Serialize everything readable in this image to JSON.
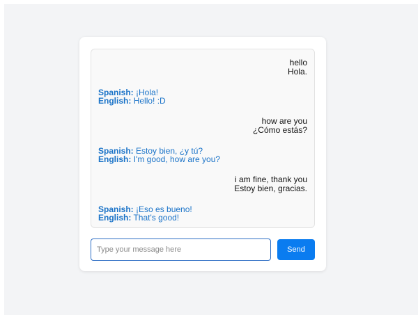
{
  "chat": {
    "messages": [
      {
        "role": "user",
        "text": "hello",
        "translation": "Hola."
      },
      {
        "role": "bot",
        "spanish_label": "Spanish:",
        "spanish": "¡Hola!",
        "english_label": "English:",
        "english": "Hello! :D"
      },
      {
        "role": "user",
        "text": "how are you",
        "translation": "¿Cómo estás?"
      },
      {
        "role": "bot",
        "spanish_label": "Spanish:",
        "spanish": "Estoy bien, ¿y tú?",
        "english_label": "English:",
        "english": "I'm good, how are you?"
      },
      {
        "role": "user",
        "text": "i am fine, thank you",
        "translation": "Estoy bien, gracias."
      },
      {
        "role": "bot",
        "spanish_label": "Spanish:",
        "spanish": "¡Eso es bueno!",
        "english_label": "English:",
        "english": "That's good!"
      }
    ]
  },
  "input": {
    "placeholder": "Type your message here",
    "value": ""
  },
  "send_label": "Send",
  "colors": {
    "accent": "#0a7cf0",
    "bot_text": "#1a73c8",
    "input_border": "#2b6cc4"
  }
}
